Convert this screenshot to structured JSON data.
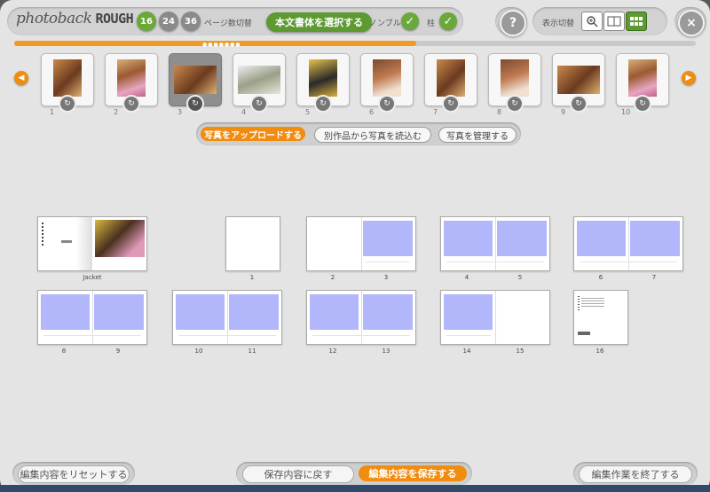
{
  "header": {
    "logo_main": "photoback",
    "logo_sub": "ROUGH",
    "page_counts": [
      "16",
      "24",
      "36"
    ],
    "page_count_label": "ページ数切替",
    "font_select_label": "本文書体を選択する",
    "nombre_label": "ノンブル",
    "hashira_label": "柱",
    "help_symbol": "?",
    "view_switch_label": "表示切替",
    "close_symbol": "×"
  },
  "progress": {
    "value": 0.59
  },
  "thumbnails": {
    "numbers": [
      "1",
      "2",
      "3",
      "4",
      "5",
      "6",
      "7",
      "8",
      "9",
      "10"
    ],
    "selected": "3"
  },
  "photo_actions": {
    "upload": "写真をアップロードする",
    "import": "別作品から写真を読込む",
    "manage": "写真を管理する"
  },
  "spreads": {
    "labels": [
      "Jacket",
      "1",
      "2",
      "3",
      "4",
      "5",
      "6",
      "7",
      "8",
      "9",
      "10",
      "11",
      "12",
      "13",
      "14",
      "15",
      "16"
    ]
  },
  "footer": {
    "reset": "編集内容をリセットする",
    "revert": "保存内容に戻す",
    "save": "編集内容を保存する",
    "finish": "編集作業を終了する"
  },
  "colors": {
    "accent_orange": "#f08c10",
    "accent_green": "#6aa83a",
    "placeholder_blue": "#b2b7fb"
  }
}
